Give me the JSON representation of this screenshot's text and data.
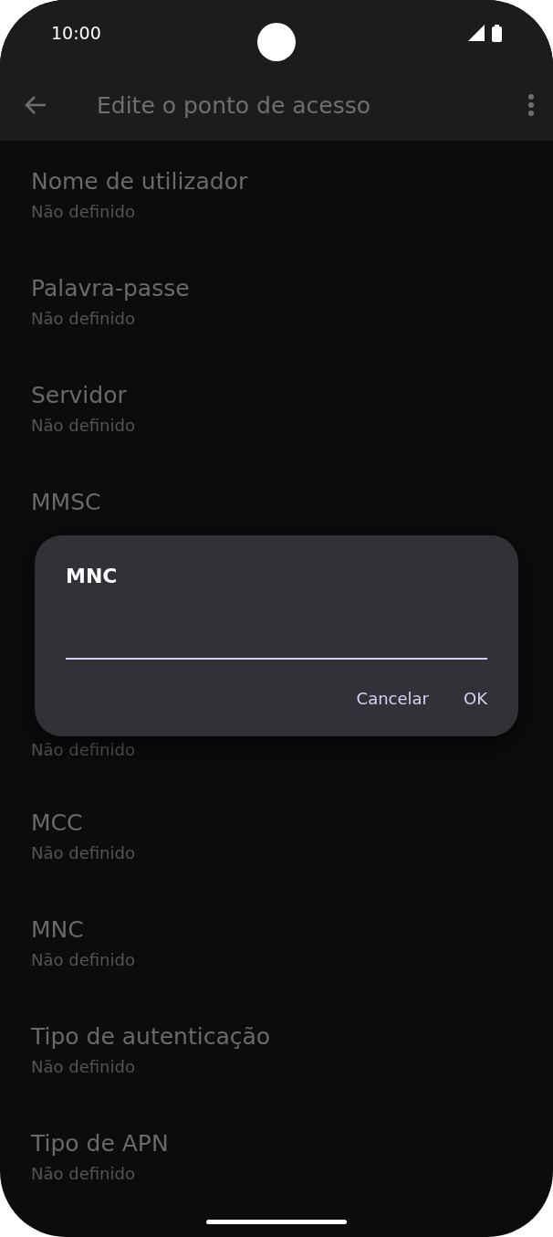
{
  "status_bar": {
    "time": "10:00"
  },
  "app_bar": {
    "title": "Edite o ponto de acesso"
  },
  "settings": [
    {
      "kind": "setting",
      "title": "Nome de utilizador",
      "subtitle": "Não definido"
    },
    {
      "kind": "setting",
      "title": "Palavra-passe",
      "subtitle": "Não definido"
    },
    {
      "kind": "setting",
      "title": "Servidor",
      "subtitle": "Não definido"
    },
    {
      "kind": "title_only",
      "title": "MMSC"
    },
    {
      "kind": "covered"
    },
    {
      "kind": "value_only",
      "subtitle": "Não definido"
    },
    {
      "kind": "setting",
      "title": "MCC",
      "subtitle": "Não definido"
    },
    {
      "kind": "setting",
      "title": "MNC",
      "subtitle": "Não definido"
    },
    {
      "kind": "setting",
      "title": "Tipo de autenticação",
      "subtitle": "Não definido"
    },
    {
      "kind": "setting",
      "title": "Tipo de APN",
      "subtitle": "Não definido"
    }
  ],
  "dialog": {
    "title": "MNC",
    "buttons": [
      "Cancelar",
      "OK"
    ]
  }
}
